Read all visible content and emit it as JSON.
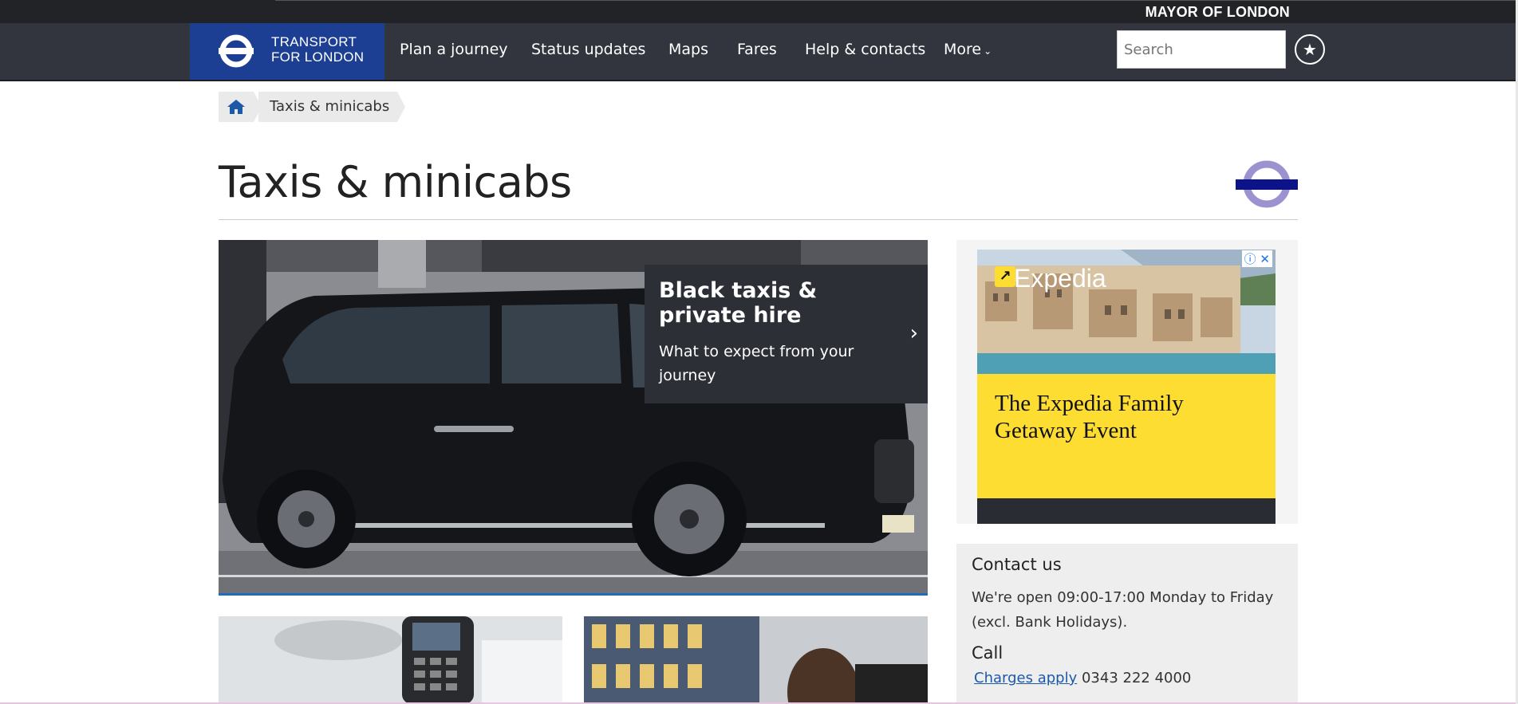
{
  "top": {
    "mayor": "MAYOR OF LONDON"
  },
  "nav": {
    "logo": {
      "line1": "TRANSPORT",
      "line2": "FOR LONDON"
    },
    "items": [
      "Plan a journey",
      "Status updates",
      "Maps",
      "Fares",
      "Help & contacts",
      "More"
    ],
    "search_placeholder": "Search"
  },
  "breadcrumb": {
    "current": "Taxis & minicabs"
  },
  "page": {
    "title": "Taxis & minicabs"
  },
  "hero": {
    "title": "Black taxis & private hire",
    "subtitle": "What to expect from your journey"
  },
  "ad": {
    "brand": "Expedia",
    "headline": "The Expedia Family Getaway Event"
  },
  "contact": {
    "heading": "Contact us",
    "hours": "We're open 09:00-17:00 Monday to Friday (excl. Bank Holidays).",
    "call_heading": "Call",
    "charges_link": "Charges apply",
    "phone": "0343 222 4000"
  },
  "colors": {
    "brand_blue": "#1c3f94",
    "nav_bg": "#33353e",
    "roundel_purple": "#9b92cf",
    "roundel_bar": "#0c1388"
  }
}
